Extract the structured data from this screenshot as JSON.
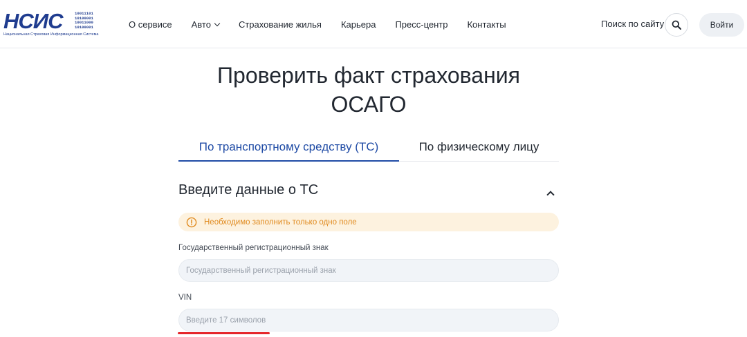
{
  "header": {
    "logo": {
      "letters": "НСИС",
      "bits": [
        "10011101",
        "10100001",
        "10011000",
        "10100001"
      ],
      "caption": "Национальная Страховая Информационная Система"
    },
    "nav": [
      {
        "label": "О сервисе"
      },
      {
        "label": "Авто",
        "has_dropdown": true
      },
      {
        "label": "Страхование жилья"
      },
      {
        "label": "Карьера"
      },
      {
        "label": "Пресс-центр"
      },
      {
        "label": "Контакты"
      }
    ],
    "search_label": "Поиск по сайту",
    "search_icon": "search-icon",
    "login_label": "Войти"
  },
  "main": {
    "title": "Проверить факт страхования ОСАГО",
    "tabs": [
      {
        "label": "По транспортному средству (ТС)",
        "active": true
      },
      {
        "label": "По физическому лицу",
        "active": false
      }
    ],
    "section_title": "Введите данные о ТС",
    "collapse_icon": "chevron-up-icon",
    "notice": {
      "icon": "warning-circle-icon",
      "text": "Необходимо заполнить только одно поле"
    },
    "fields": [
      {
        "label": "Государственный регистрационный знак",
        "placeholder": "Государственный регистрационный знак",
        "value": ""
      },
      {
        "label": "VIN",
        "placeholder": "Введите 17 символов",
        "value": ""
      }
    ]
  },
  "colors": {
    "brand": "#1f3c8f",
    "active_tab": "#1f4ba5",
    "notice_bg": "#fdf2df",
    "notice_text": "#e08a1e",
    "annotation_mark": "#e5262b"
  }
}
